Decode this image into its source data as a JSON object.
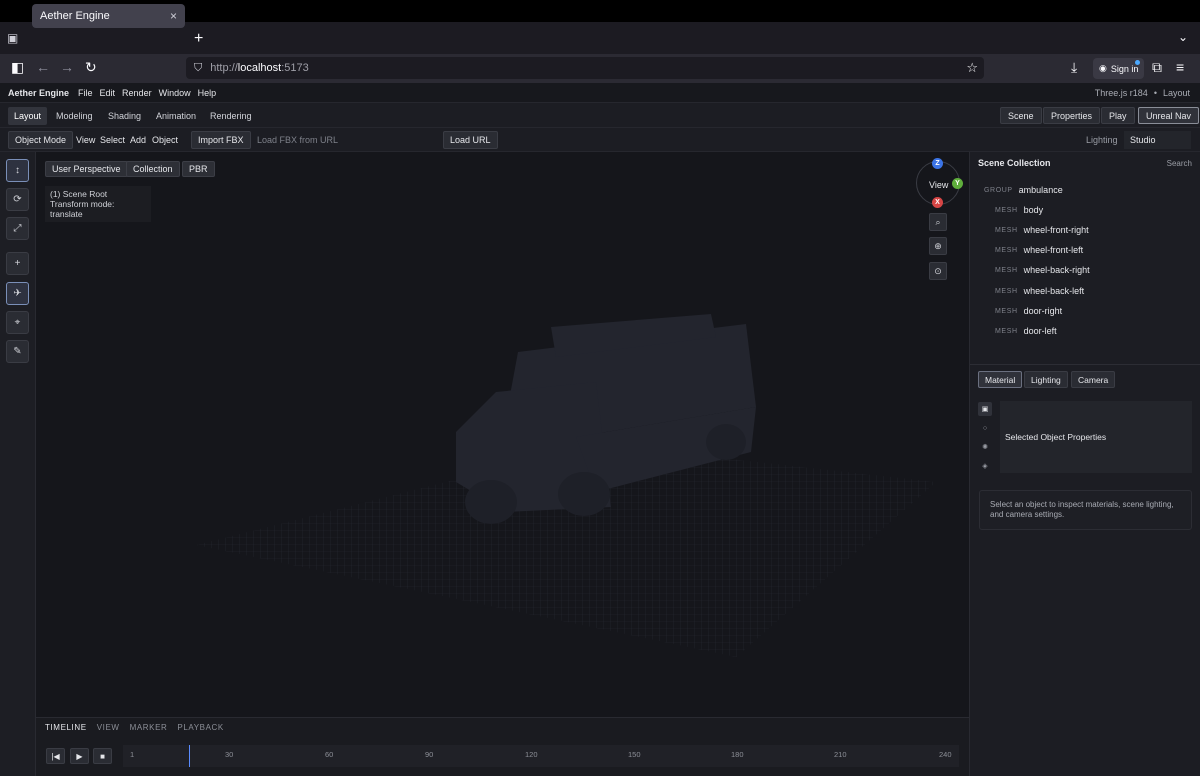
{
  "browser": {
    "tab_title": "Aether Engine",
    "tab_close": "×",
    "new_tab": "+",
    "url_proto": "http://",
    "url_host": "localhost",
    "url_port": ":5173",
    "sign_in": "Sign in"
  },
  "menubar": {
    "brand": "Aether Engine",
    "items": [
      "File",
      "Edit",
      "Render",
      "Window",
      "Help"
    ],
    "version": "Three.js r184",
    "workspace": "Layout"
  },
  "modes": {
    "tabs": [
      "Layout",
      "Modeling",
      "Shading",
      "Animation",
      "Rendering"
    ],
    "right_buttons": [
      "Scene",
      "Properties",
      "Play",
      "Unreal Nav"
    ]
  },
  "toolrow": {
    "object_mode": "Object Mode",
    "menus": [
      "View",
      "Select",
      "Add",
      "Object"
    ],
    "import_fbx": "Import FBX",
    "url_placeholder": "Load FBX from URL",
    "load_url": "Load URL",
    "lighting_label": "Lighting",
    "lighting_value": "Studio"
  },
  "viewport": {
    "buttons": [
      "User Perspective",
      "Collection",
      "PBR"
    ],
    "info_line1": "(1) Scene Root",
    "info_line2": "Transform mode: translate",
    "gizmo_label": "View",
    "axes": {
      "z": "Z",
      "y": "Y",
      "x": "X"
    },
    "colors": {
      "z": "#3b74e6",
      "y": "#5fae3c",
      "x": "#d64545"
    }
  },
  "timeline": {
    "tabs": [
      "TIMELINE",
      "VIEW",
      "MARKER",
      "PLAYBACK"
    ],
    "ticks": [
      "1",
      "30",
      "60",
      "90",
      "120",
      "150",
      "180",
      "210",
      "240"
    ]
  },
  "scene_panel": {
    "title": "Scene Collection",
    "search": "Search",
    "group_kind": "GROUP",
    "group_name": "ambulance",
    "mesh_kind": "MESH",
    "meshes": [
      "body",
      "wheel-front-right",
      "wheel-front-left",
      "wheel-back-right",
      "wheel-back-left",
      "door-right",
      "door-left"
    ]
  },
  "properties": {
    "tabs": [
      "Material",
      "Lighting",
      "Camera"
    ],
    "box_label": "Selected Object Properties",
    "hint": "Select an object to inspect materials, scene lighting, and camera settings."
  }
}
